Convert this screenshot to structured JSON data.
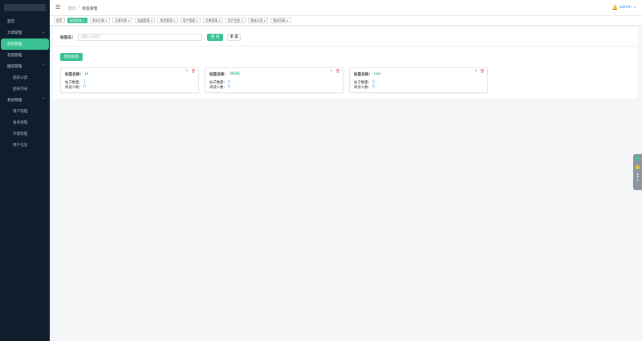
{
  "sidebar": {
    "items": [
      {
        "label": "首页",
        "type": "item"
      },
      {
        "label": "文章管理",
        "type": "group"
      },
      {
        "label": "标签管理",
        "type": "item-active"
      },
      {
        "label": "友链管理",
        "type": "item"
      },
      {
        "label": "图床管理",
        "type": "group"
      },
      {
        "label": "图床分类",
        "type": "sub"
      },
      {
        "label": "图床列表",
        "type": "sub"
      },
      {
        "label": "系统管理",
        "type": "group"
      },
      {
        "label": "用户管理",
        "type": "sub"
      },
      {
        "label": "角色管理",
        "type": "sub"
      },
      {
        "label": "字典管理",
        "type": "sub"
      },
      {
        "label": "用户信息",
        "type": "sub"
      }
    ]
  },
  "header": {
    "breadcrumb_home": "首页",
    "breadcrumb_sep": "/",
    "breadcrumb_current": "标签管理",
    "user_name": "admin"
  },
  "tags": [
    {
      "label": "首页",
      "active": false,
      "closable": false
    },
    {
      "label": "标签管理",
      "active": true,
      "closable": true
    },
    {
      "label": "发布文章",
      "active": false,
      "closable": true
    },
    {
      "label": "文章列表",
      "active": false,
      "closable": true
    },
    {
      "label": "友链管理",
      "active": false,
      "closable": true
    },
    {
      "label": "角色管理",
      "active": false,
      "closable": true
    },
    {
      "label": "用户管理",
      "active": false,
      "closable": true
    },
    {
      "label": "字典管理",
      "active": false,
      "closable": true
    },
    {
      "label": "用户信息",
      "active": false,
      "closable": true
    },
    {
      "label": "图床分类",
      "active": false,
      "closable": true
    },
    {
      "label": "图床列表",
      "active": false,
      "closable": true
    }
  ],
  "search": {
    "label": "标签名：",
    "placeholder": "请输入标签名",
    "search_button": "搜 索",
    "reset_button": "重 置"
  },
  "add_button": "增加标签",
  "cards": [
    {
      "name_label": "标签名称：",
      "name": "js",
      "count_label": "帖子数量：",
      "count": "1",
      "readers_label": "阅读人数：",
      "readers": "0"
    },
    {
      "name_label": "标签名称：",
      "name": "2026",
      "count_label": "帖子数量：",
      "count": "0",
      "readers_label": "阅读人数：",
      "readers": "0"
    },
    {
      "name_label": "标签名称：",
      "name": "css",
      "count_label": "帖子数量：",
      "count": "0",
      "readers_label": "阅读人数：",
      "readers": "0"
    }
  ],
  "colors": {
    "accent": "#3ac293",
    "sidebar_bg": "#0f1e2d",
    "link": "#3a8ee6",
    "danger": "#f56c6c"
  },
  "icons": {
    "menu_toggle": "hamburger-icon",
    "bell": "bell-icon",
    "edit": "edit-icon",
    "delete": "trash-icon"
  }
}
